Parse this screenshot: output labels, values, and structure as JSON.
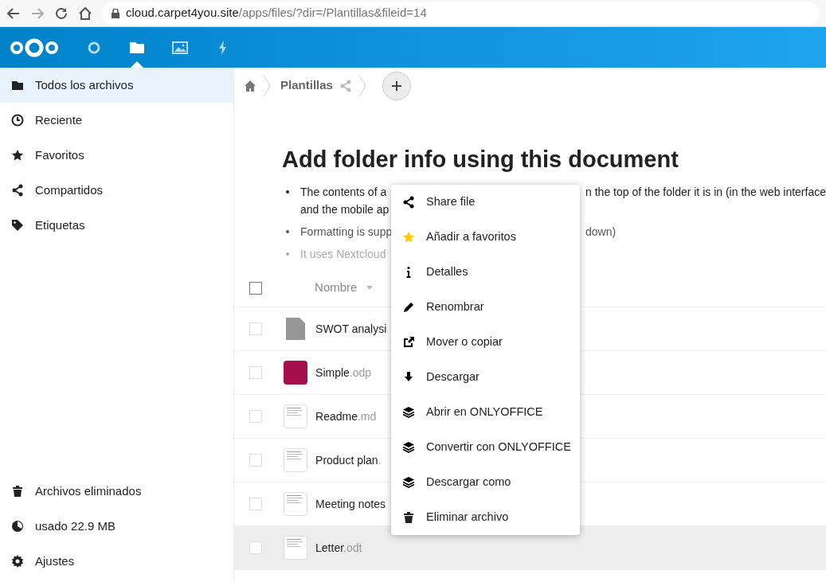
{
  "browser": {
    "url_host": "cloud.carpet4you.site",
    "url_path": "/apps/files/?dir=/Plantillas&fileid=14"
  },
  "header": {
    "apps": [
      {
        "kind": "dashboard",
        "selected": false
      },
      {
        "kind": "files",
        "selected": true
      },
      {
        "kind": "photos",
        "selected": false
      },
      {
        "kind": "activity",
        "selected": false
      }
    ]
  },
  "sidebar": {
    "items": [
      {
        "kind": "folder",
        "label": "Todos los archivos",
        "selected": true
      },
      {
        "kind": "clock",
        "label": "Reciente",
        "selected": false
      },
      {
        "kind": "star",
        "label": "Favoritos",
        "selected": false
      },
      {
        "kind": "share",
        "label": "Compartidos",
        "selected": false
      },
      {
        "kind": "tag",
        "label": "Etiquetas",
        "selected": false
      }
    ],
    "bottom": [
      {
        "kind": "trash",
        "label": "Archivos eliminados"
      },
      {
        "kind": "quota",
        "label": "usado 22.9 MB"
      },
      {
        "kind": "gear",
        "label": "Ajustes"
      }
    ]
  },
  "breadcrumb": {
    "folder": "Plantillas"
  },
  "readme": {
    "title": "Add folder info using this document",
    "bullets": [
      {
        "left": "The contents of a",
        "right": "n the top of the folder it is in (in the web interface",
        "line2": "and the mobile ap",
        "kind": "dark"
      },
      {
        "left": "Formatting is supp",
        "right": "down)",
        "kind": "mid"
      },
      {
        "left": "It uses Nextcloud",
        "kind": "light"
      }
    ]
  },
  "table": {
    "select_all": {
      "checked": false
    },
    "column": "Nombre",
    "rows": [
      {
        "name": "SWOT analysi",
        "ext": "",
        "kind": "blank",
        "selected": false
      },
      {
        "name": "Simple",
        "ext": ".odp",
        "kind": "slide",
        "selected": false
      },
      {
        "name": "Readme",
        "ext": ".md",
        "kind": "doc",
        "selected": false
      },
      {
        "name": "Product plan",
        "ext": ".",
        "kind": "doc",
        "selected": false
      },
      {
        "name": "Meeting notes",
        "ext": "",
        "kind": "doc",
        "selected": false
      },
      {
        "name": "Letter",
        "ext": ".odt",
        "kind": "doc",
        "selected": true
      }
    ]
  },
  "context_menu": [
    {
      "kind": "share",
      "label": "Share file"
    },
    {
      "kind": "star",
      "label": "Añadir a favoritos"
    },
    {
      "kind": "info",
      "label": "Detalles"
    },
    {
      "kind": "pencil",
      "label": "Renombrar"
    },
    {
      "kind": "external",
      "label": "Mover o copiar"
    },
    {
      "kind": "download",
      "label": "Descargar"
    },
    {
      "kind": "layers",
      "label": "Abrir en ONLYOFFICE"
    },
    {
      "kind": "layers",
      "label": "Convertir con ONLYOFFICE"
    },
    {
      "kind": "layers",
      "label": "Descargar como"
    },
    {
      "kind": "trash",
      "label": "Eliminar archivo"
    }
  ]
}
